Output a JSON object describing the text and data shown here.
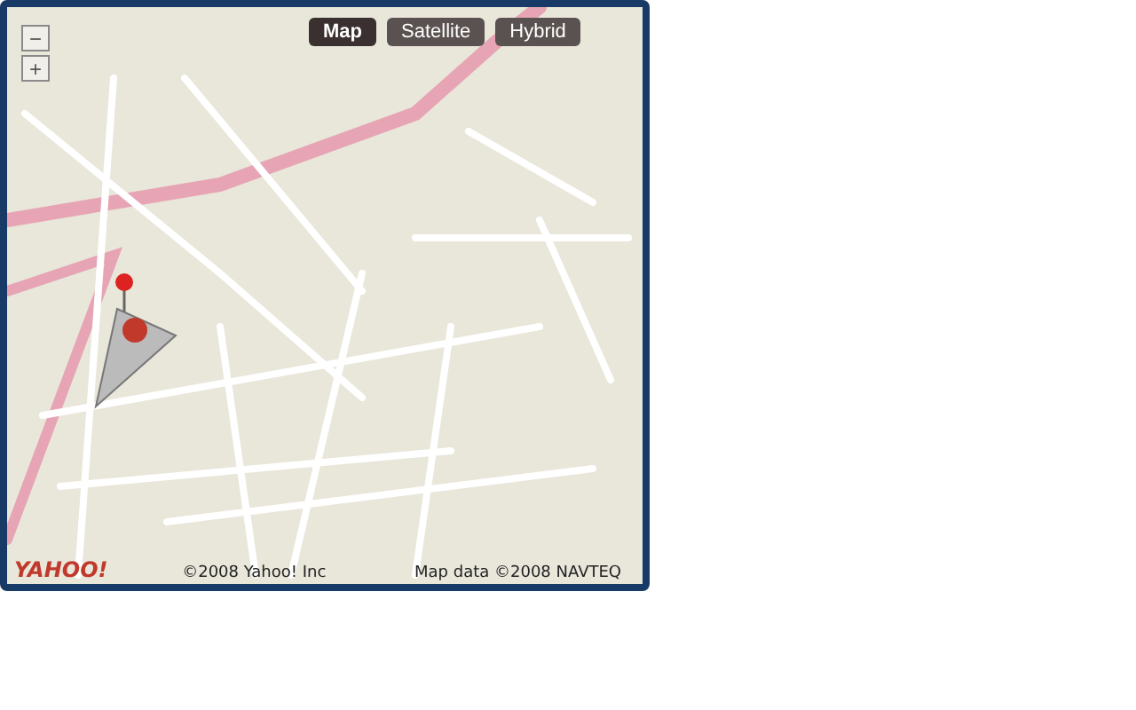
{
  "zoom_controls": [
    {
      "label": "−"
    },
    {
      "label": "+"
    }
  ],
  "map_types": [
    {
      "label": "Map",
      "selected": true
    },
    {
      "label": "Satellite",
      "selected": false
    },
    {
      "label": "Hybrid",
      "selected": false
    }
  ],
  "logo": "YAHOO!",
  "copyright": "©2008 Yahoo! Inc",
  "map_data": "Map data ©2008 NAVTEQ"
}
